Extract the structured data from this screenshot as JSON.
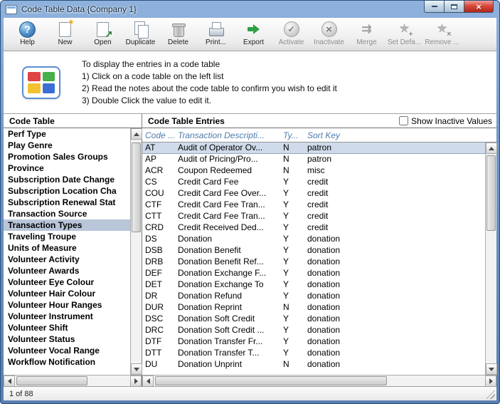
{
  "window": {
    "title": "Code Table Data {Company 1}",
    "status_text": "1 of 88"
  },
  "colors": {
    "selection_list": "#b9c6d9",
    "selection_row": "#cfdbea",
    "column_header_text": "#4e7cae",
    "titlebar_close": "#b02718"
  },
  "toolbar": {
    "items": [
      {
        "id": "help",
        "label": "Help",
        "enabled": true
      },
      {
        "id": "new",
        "label": "New",
        "enabled": true
      },
      {
        "id": "open",
        "label": "Open",
        "enabled": true
      },
      {
        "id": "duplicate",
        "label": "Duplicate",
        "enabled": true
      },
      {
        "id": "delete",
        "label": "Delete",
        "enabled": true
      },
      {
        "id": "print",
        "label": "Print...",
        "enabled": true
      },
      {
        "id": "export",
        "label": "Export",
        "enabled": true
      },
      {
        "id": "activate",
        "label": "Activate",
        "enabled": false
      },
      {
        "id": "inactivate",
        "label": "Inactivate",
        "enabled": false
      },
      {
        "id": "merge",
        "label": "Merge",
        "enabled": false
      },
      {
        "id": "set-default",
        "label": "Set Defa...",
        "enabled": false
      },
      {
        "id": "remove",
        "label": "Remove ...",
        "enabled": false
      }
    ]
  },
  "instructions": {
    "intro": "To display the entries in a code table",
    "steps": [
      "1) Click on a code table on the left list",
      "2) Read the notes about the code table to confirm you wish to edit it",
      "3) Double Click the value to edit it."
    ]
  },
  "code_table_panel": {
    "header": "Code Table",
    "selected": "Transaction Types",
    "items": [
      "Perf Type",
      "Play Genre",
      "Promotion Sales Groups",
      "Province",
      "Subscription Date Change",
      "Subscription Location Cha",
      "Subscription Renewal Stat",
      "Transaction Source",
      "Transaction Types",
      "Traveling Troupe",
      "Units of Measure",
      "Volunteer Activity",
      "Volunteer Awards",
      "Volunteer Eye Colour",
      "Volunteer Hair Colour",
      "Volunteer Hour Ranges",
      "Volunteer Instrument",
      "Volunteer Shift",
      "Volunteer Status",
      "Volunteer Vocal Range",
      "Workflow Notification"
    ]
  },
  "entries_panel": {
    "header": "Code Table Entries",
    "show_inactive_label": "Show Inactive Values",
    "columns": [
      "Code ...",
      "Transaction Descripti...",
      "Ty...",
      "Sort Key"
    ],
    "selected_index": 0,
    "rows": [
      [
        "AT",
        "Audit of Operator Ov...",
        "N",
        "patron"
      ],
      [
        "AP",
        "Audit of Pricing/Pro...",
        "N",
        "patron"
      ],
      [
        "ACR",
        "Coupon Redeemed",
        "N",
        "misc"
      ],
      [
        "CS",
        "Credit Card Fee",
        "Y",
        "credit"
      ],
      [
        "COU",
        "Credit Card Fee Over...",
        "Y",
        "credit"
      ],
      [
        "CTF",
        "Credit Card Fee Tran...",
        "Y",
        "credit"
      ],
      [
        "CTT",
        "Credit Card Fee Tran...",
        "Y",
        "credit"
      ],
      [
        "CRD",
        "Credit Received Ded...",
        "Y",
        "credit"
      ],
      [
        "DS",
        "Donation",
        "Y",
        "donation"
      ],
      [
        "DSB",
        "Donation Benefit",
        "Y",
        "donation"
      ],
      [
        "DRB",
        "Donation Benefit Ref...",
        "Y",
        "donation"
      ],
      [
        "DEF",
        "Donation Exchange F...",
        "Y",
        "donation"
      ],
      [
        "DET",
        "Donation Exchange To",
        "Y",
        "donation"
      ],
      [
        "DR",
        "Donation Refund",
        "Y",
        "donation"
      ],
      [
        "DUR",
        "Donation Reprint",
        "N",
        "donation"
      ],
      [
        "DSC",
        "Donation Soft Credit",
        "Y",
        "donation"
      ],
      [
        "DRC",
        "Donation Soft Credit ...",
        "Y",
        "donation"
      ],
      [
        "DTF",
        "Donation Transfer Fr...",
        "Y",
        "donation"
      ],
      [
        "DTT",
        "Donation Transfer T...",
        "Y",
        "donation"
      ],
      [
        "DU",
        "Donation Unprint",
        "N",
        "donation"
      ]
    ]
  }
}
